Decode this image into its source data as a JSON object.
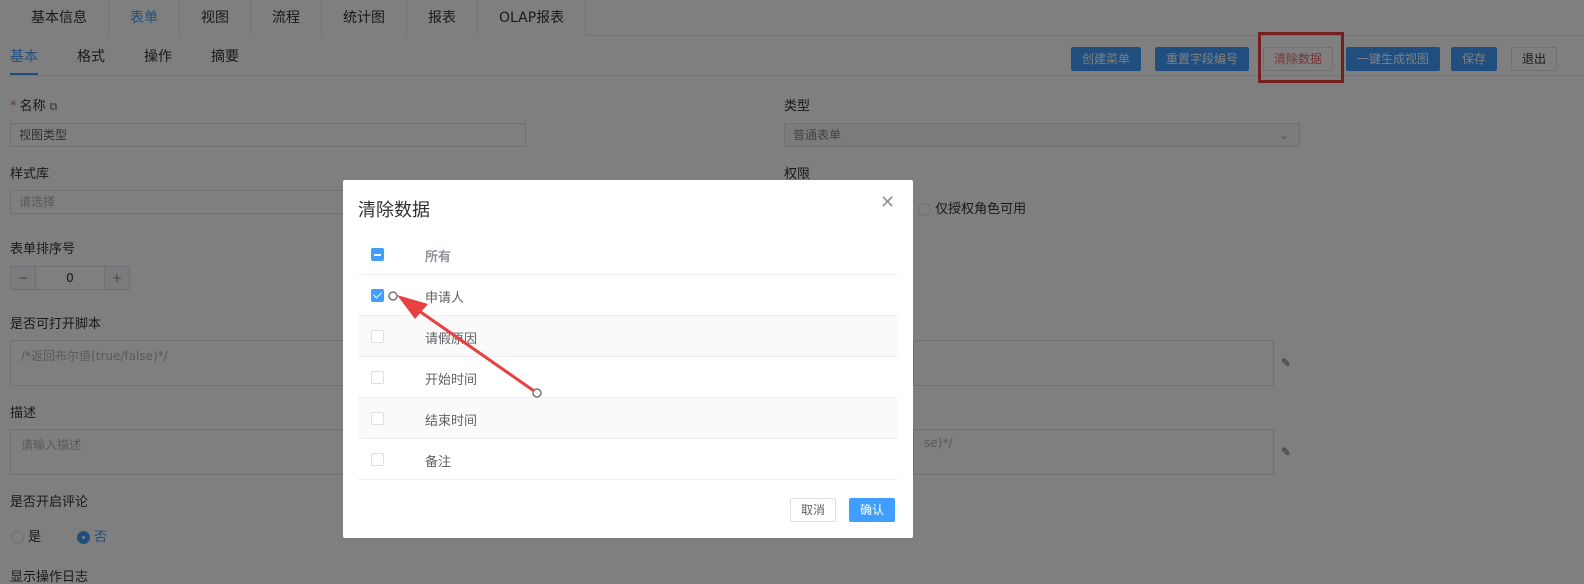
{
  "top_tabs": [
    "基本信息",
    "表单",
    "视图",
    "流程",
    "统计图",
    "报表",
    "OLAP报表"
  ],
  "sub_tabs": [
    "基本",
    "格式",
    "操作",
    "摘要"
  ],
  "toolbar": {
    "create_menu": "创建菜单",
    "reset_field_no": "重置字段编号",
    "clear_data": "清除数据",
    "gen_view": "一键生成视图",
    "save": "保存",
    "exit": "退出"
  },
  "form": {
    "name_label": "名称",
    "name_value": "视图类型",
    "type_label": "类型",
    "type_value": "普通表单",
    "style_label": "样式库",
    "style_placeholder": "请选择",
    "perm_label": "权限",
    "perm_option": "仅授权角色可用",
    "sort_label": "表单排序号",
    "sort_value": "0",
    "script_label": "是否可打开脚本",
    "script_placeholder": "/*返回布尔值(true/false)*/",
    "desc_label": "描述",
    "desc_placeholder": "请输入描述",
    "desc_right_text": "se)*/",
    "comment_label": "是否开启评论",
    "comment_yes": "是",
    "comment_no": "否",
    "log_label": "显示操作日志"
  },
  "dialog": {
    "title": "清除数据",
    "header": "所有",
    "rows": [
      {
        "label": "申请人",
        "checked": true
      },
      {
        "label": "请假原因",
        "checked": false
      },
      {
        "label": "开始时间",
        "checked": false
      },
      {
        "label": "结束时间",
        "checked": false
      },
      {
        "label": "备注",
        "checked": false
      }
    ],
    "cancel": "取消",
    "confirm": "确认"
  },
  "colors": {
    "accent": "#409eff",
    "danger": "#f56c6c",
    "annotation": "#e84141"
  }
}
